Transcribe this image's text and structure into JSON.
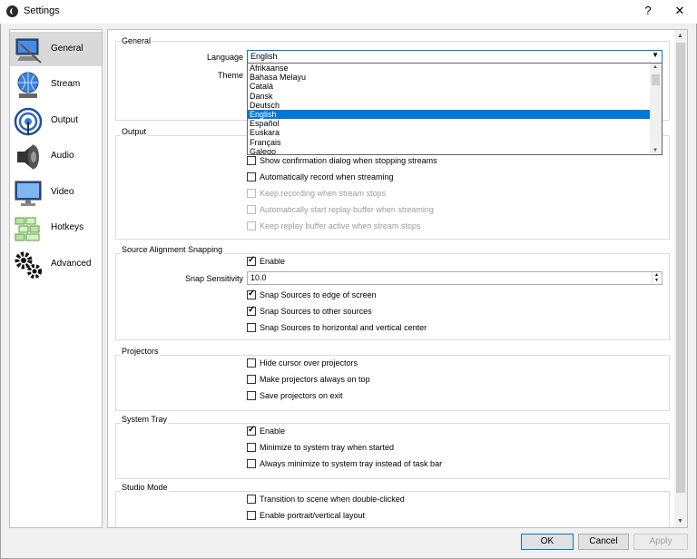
{
  "window": {
    "title": "Settings",
    "help_label": "?",
    "close_label": "✕"
  },
  "sidebar": {
    "items": [
      {
        "label": "General",
        "icon": "general-monitor-icon",
        "selected": true
      },
      {
        "label": "Stream",
        "icon": "stream-globe-icon"
      },
      {
        "label": "Output",
        "icon": "output-broadcast-icon"
      },
      {
        "label": "Audio",
        "icon": "audio-speaker-icon"
      },
      {
        "label": "Video",
        "icon": "video-monitor-icon"
      },
      {
        "label": "Hotkeys",
        "icon": "hotkeys-keyboard-icon"
      },
      {
        "label": "Advanced",
        "icon": "advanced-gears-icon"
      }
    ]
  },
  "general": {
    "title": "General",
    "language_label": "Language",
    "language_value": "English",
    "theme_label": "Theme"
  },
  "language_options": [
    "Afrikaanse",
    "Bahasa Melayu",
    "Català",
    "Dansk",
    "Deutsch",
    "English",
    "Español",
    "Euskara",
    "Français",
    "Galego"
  ],
  "language_selected_index": 5,
  "output": {
    "title": "Output",
    "checks": [
      {
        "label": "Show confirmation dialog when stopping streams",
        "checked": false,
        "enabled": true
      },
      {
        "label": "Automatically record when streaming",
        "checked": false,
        "enabled": true
      },
      {
        "label": "Keep recording when stream stops",
        "checked": false,
        "enabled": false
      },
      {
        "label": "Automatically start replay buffer when streaming",
        "checked": false,
        "enabled": false
      },
      {
        "label": "Keep replay buffer active when stream stops",
        "checked": false,
        "enabled": false
      }
    ]
  },
  "snapping": {
    "title": "Source Alignment Snapping",
    "enable_label": "Enable",
    "sensitivity_label": "Snap Sensitivity",
    "sensitivity_value": "10.0",
    "checks": [
      {
        "label": "Snap Sources to edge of screen",
        "checked": true
      },
      {
        "label": "Snap Sources to other sources",
        "checked": true
      },
      {
        "label": "Snap Sources to horizontal and vertical center",
        "checked": false
      }
    ]
  },
  "projectors": {
    "title": "Projectors",
    "checks": [
      {
        "label": "Hide cursor over projectors",
        "checked": false
      },
      {
        "label": "Make projectors always on top",
        "checked": false
      },
      {
        "label": "Save projectors on exit",
        "checked": false
      }
    ]
  },
  "tray": {
    "title": "System Tray",
    "checks": [
      {
        "label": "Enable",
        "checked": true
      },
      {
        "label": "Minimize to system tray when started",
        "checked": false
      },
      {
        "label": "Always minimize to system tray instead of task bar",
        "checked": false
      }
    ]
  },
  "studio": {
    "title": "Studio Mode",
    "checks": [
      {
        "label": "Transition to scene when double-clicked",
        "checked": false
      },
      {
        "label": "Enable portrait/vertical layout",
        "checked": false
      }
    ]
  },
  "buttons": {
    "ok": "OK",
    "cancel": "Cancel",
    "apply": "Apply"
  },
  "colors": {
    "accent": "#0078d7",
    "selected_sidebar": "#d9d9d9"
  }
}
